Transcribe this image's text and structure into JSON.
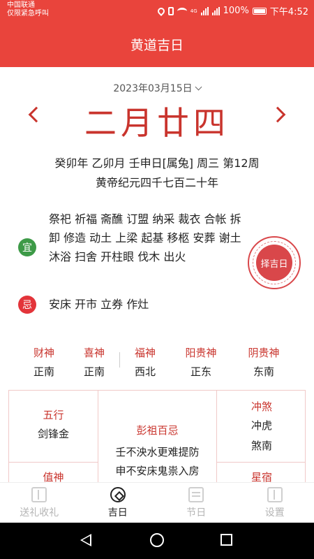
{
  "status_bar": {
    "carrier_line1": "中国联通",
    "carrier_line2": "仅限紧急呼叫",
    "signal_4g": "4G",
    "battery": "100%",
    "time": "下午4:52"
  },
  "header": {
    "title": "黄道吉日"
  },
  "date": {
    "gregorian": "2023年03月15日",
    "lunar": "二月廿四",
    "ganzhi_line": "癸卯年 乙卯月 壬申日[属兔] 周三 第12周",
    "era_line": "黄帝纪元四千七百二十年"
  },
  "yi": {
    "badge": "宜",
    "text": "祭祀 祈福 斋醮 订盟 纳采 裁衣 合帐 拆卸 修造 动土 上梁 起基 移柩 安葬 谢土 沐浴 扫舍 开柱眼 伐木 出火"
  },
  "ji": {
    "badge": "忌",
    "text": "安床 开市 立券 作灶"
  },
  "seal": {
    "label": "择吉日"
  },
  "gods": [
    {
      "name": "财神",
      "dir": "正南"
    },
    {
      "name": "喜神",
      "dir": "正南"
    },
    {
      "name": "福神",
      "dir": "西北"
    },
    {
      "name": "阳贵神",
      "dir": "正东"
    },
    {
      "name": "阴贵神",
      "dir": "东南"
    }
  ],
  "grid": {
    "wuxing": {
      "title": "五行",
      "value": "剑锋金"
    },
    "pengzu": {
      "title": "彭祖百忌",
      "line1": "壬不泱水更难提防",
      "line2": "申不安床鬼祟入房"
    },
    "chongsha": {
      "title": "冲煞",
      "line1": "冲虎",
      "line2": "煞南"
    },
    "zhishen": {
      "title": "值神"
    },
    "xingxiu": {
      "title": "星宿"
    }
  },
  "tabs": [
    {
      "label": "送礼收礼",
      "icon": "book-icon",
      "active": false
    },
    {
      "label": "吉日",
      "icon": "compass-icon",
      "active": true
    },
    {
      "label": "节日",
      "icon": "calendar-icon",
      "active": false
    },
    {
      "label": "设置",
      "icon": "settings-book-icon",
      "active": false
    }
  ]
}
